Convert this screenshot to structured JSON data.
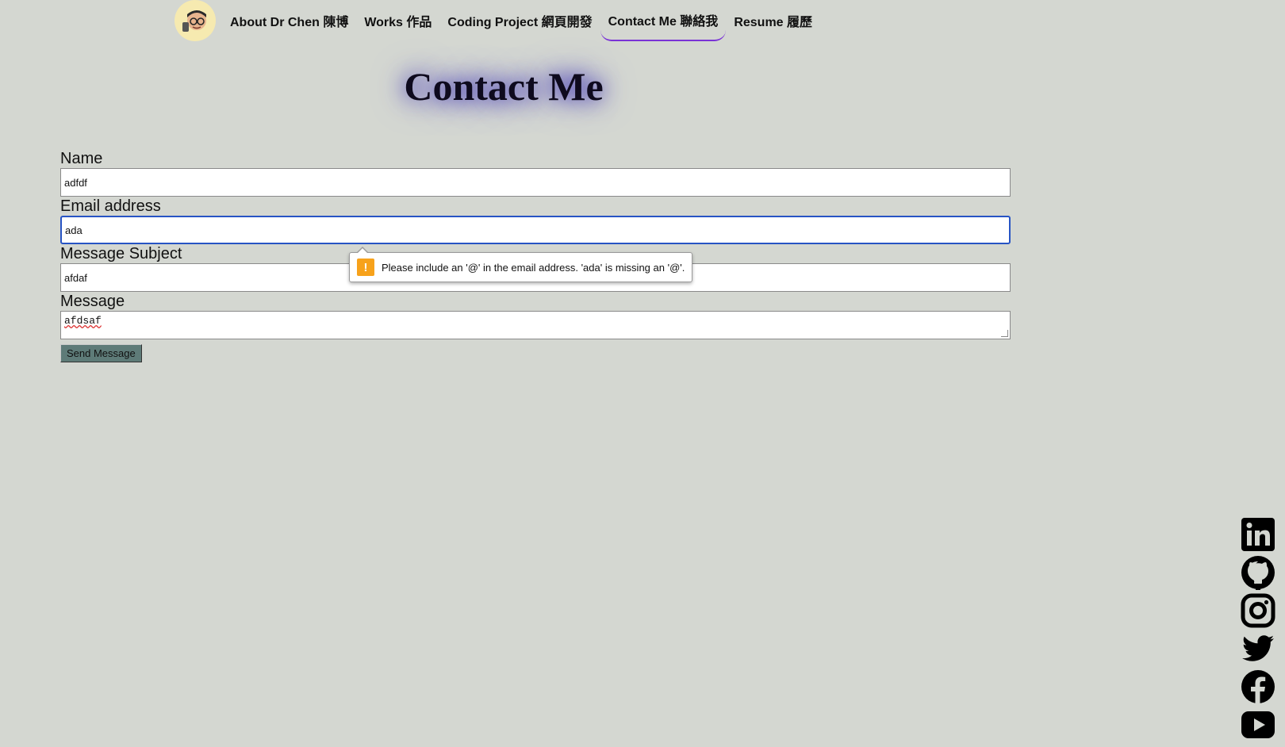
{
  "nav": {
    "items": [
      {
        "label": "About Dr Chen 陳博",
        "active": false
      },
      {
        "label": "Works 作品",
        "active": false
      },
      {
        "label": "Coding Project 網頁開發",
        "active": false
      },
      {
        "label": "Contact Me 聯絡我",
        "active": true
      },
      {
        "label": "Resume 履歷",
        "active": false
      }
    ],
    "accent_color": "#7a33d6"
  },
  "page_title": "Contact Me",
  "form": {
    "name_label": "Name",
    "name_value": "adfdf",
    "email_label": "Email address",
    "email_value": "ada",
    "subject_label": "Message Subject",
    "subject_value": "afdaf",
    "message_label": "Message",
    "message_value": "afdsaf",
    "send_label": "Send Message"
  },
  "validation_tooltip": {
    "icon": "warning-icon",
    "text": "Please include an '@' in the email address. 'ada' is missing an '@'."
  },
  "social": {
    "icons": [
      "linkedin-icon",
      "github-icon",
      "instagram-icon",
      "twitter-icon",
      "facebook-icon",
      "youtube-icon"
    ]
  }
}
